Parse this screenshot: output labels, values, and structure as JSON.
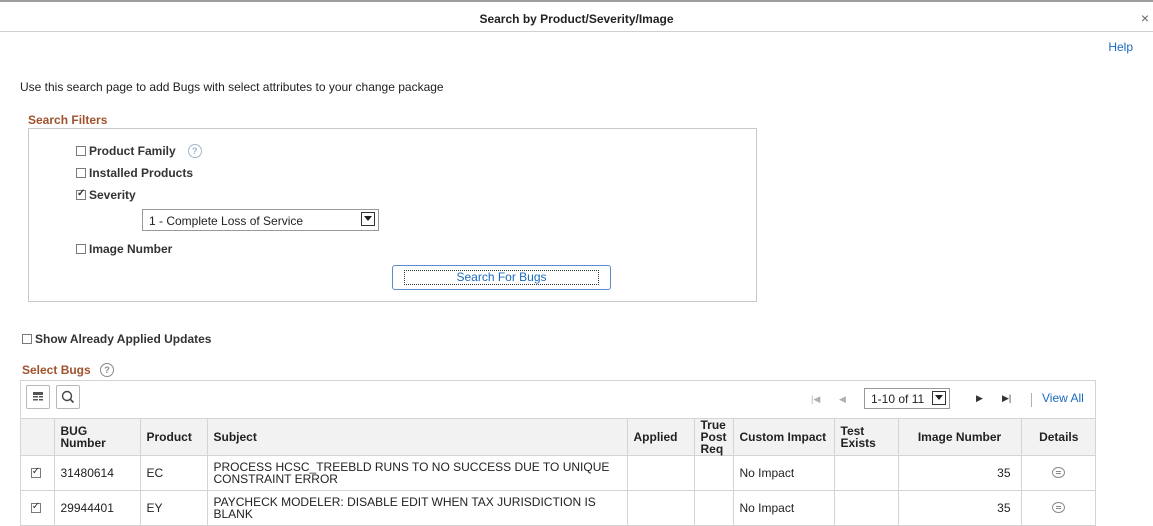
{
  "dialog": {
    "title": "Search by Product/Severity/Image",
    "close": "×",
    "help": "Help"
  },
  "intro": "Use this search page to add Bugs with select attributes to your change package",
  "filters": {
    "title": "Search Filters",
    "product_family": "Product Family",
    "installed_products": "Installed Products",
    "severity": "Severity",
    "severity_value": "1 - Complete Loss of Service",
    "image_number": "Image Number",
    "search_button": "Search For Bugs"
  },
  "show_applied": "Show Already Applied Updates",
  "grid": {
    "title": "Select Bugs",
    "pager": {
      "range": "1-10 of 11",
      "view_all": "View All"
    },
    "columns": [
      "BUG Number",
      "Product",
      "Subject",
      "Applied",
      "True Post Req",
      "Custom Impact",
      "Test Exists",
      "Image Number",
      "Details"
    ],
    "rows": [
      {
        "bug": "31480614",
        "product": "EC",
        "subject": "PROCESS HCSC_TREEBLD RUNS TO NO SUCCESS DUE TO UNIQUE CONSTRAINT ERROR",
        "applied": "",
        "true_post": "",
        "impact": "No Impact",
        "test": "",
        "image": "35"
      },
      {
        "bug": "29944401",
        "product": "EY",
        "subject": "PAYCHECK MODELER: DISABLE EDIT WHEN TAX JURISDICTION IS BLANK",
        "applied": "",
        "true_post": "",
        "impact": "No Impact",
        "test": "",
        "image": "35"
      }
    ]
  }
}
